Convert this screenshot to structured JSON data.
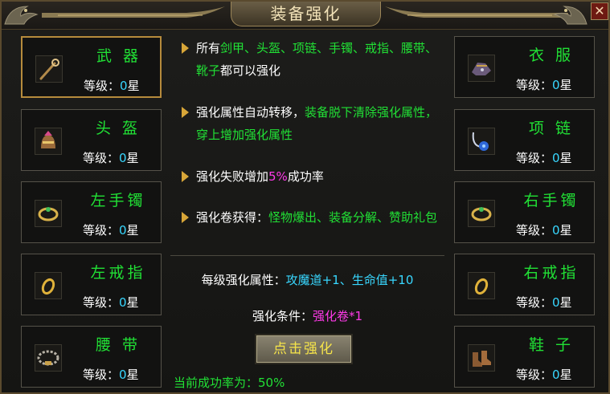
{
  "window": {
    "title": "装备强化",
    "close_label": "✕"
  },
  "left_slots": [
    {
      "name": "武 器",
      "level_label": "等级：",
      "level_value": "0",
      "level_unit": "星",
      "icon": "staff-icon",
      "selected": true
    },
    {
      "name": "头 盔",
      "level_label": "等级：",
      "level_value": "0",
      "level_unit": "星",
      "icon": "helmet-icon"
    },
    {
      "name": "左手镯",
      "level_label": "等级：",
      "level_value": "0",
      "level_unit": "星",
      "icon": "bracelet-icon"
    },
    {
      "name": "左戒指",
      "level_label": "等级：",
      "level_value": "0",
      "level_unit": "星",
      "icon": "ring-icon"
    },
    {
      "name": "腰 带",
      "level_label": "等级：",
      "level_value": "0",
      "level_unit": "星",
      "icon": "belt-icon"
    }
  ],
  "right_slots": [
    {
      "name": "衣 服",
      "level_label": "等级：",
      "level_value": "0",
      "level_unit": "星",
      "icon": "armor-icon"
    },
    {
      "name": "项 链",
      "level_label": "等级：",
      "level_value": "0",
      "level_unit": "星",
      "icon": "necklace-icon"
    },
    {
      "name": "右手镯",
      "level_label": "等级：",
      "level_value": "0",
      "level_unit": "星",
      "icon": "bracelet-icon"
    },
    {
      "name": "右戒指",
      "level_label": "等级：",
      "level_value": "0",
      "level_unit": "星",
      "icon": "ring-icon"
    },
    {
      "name": "鞋 子",
      "level_label": "等级：",
      "level_value": "0",
      "level_unit": "星",
      "icon": "boots-icon"
    }
  ],
  "tips": {
    "t1": {
      "a": "所有",
      "b": "剑甲、头盔、项链、手镯、戒指、腰带、靴子",
      "c": "都可以强化"
    },
    "t2": {
      "a": "强化属性自动转移，",
      "b": "装备脱下清除强化属性，穿上增加强化属性"
    },
    "t3": {
      "a": "强化失败增加",
      "b": "5%",
      "c": "成功率"
    },
    "t4": {
      "a": "强化卷获得：",
      "b": "怪物爆出、装备分解、赞助礼包"
    }
  },
  "per_level": {
    "label": "每级强化属性：",
    "value": "攻魔道+1、生命值+10"
  },
  "condition": {
    "label": "强化条件：",
    "value": "强化卷*1"
  },
  "button": {
    "label": "点击强化"
  },
  "success": {
    "label": "当前成功率为：",
    "value": "50%"
  },
  "colors": {
    "green": "#21e035",
    "cyan": "#38d7ff",
    "magenta": "#ff3ae9",
    "gold": "#d8a638",
    "button_text": "#f6e44a"
  }
}
